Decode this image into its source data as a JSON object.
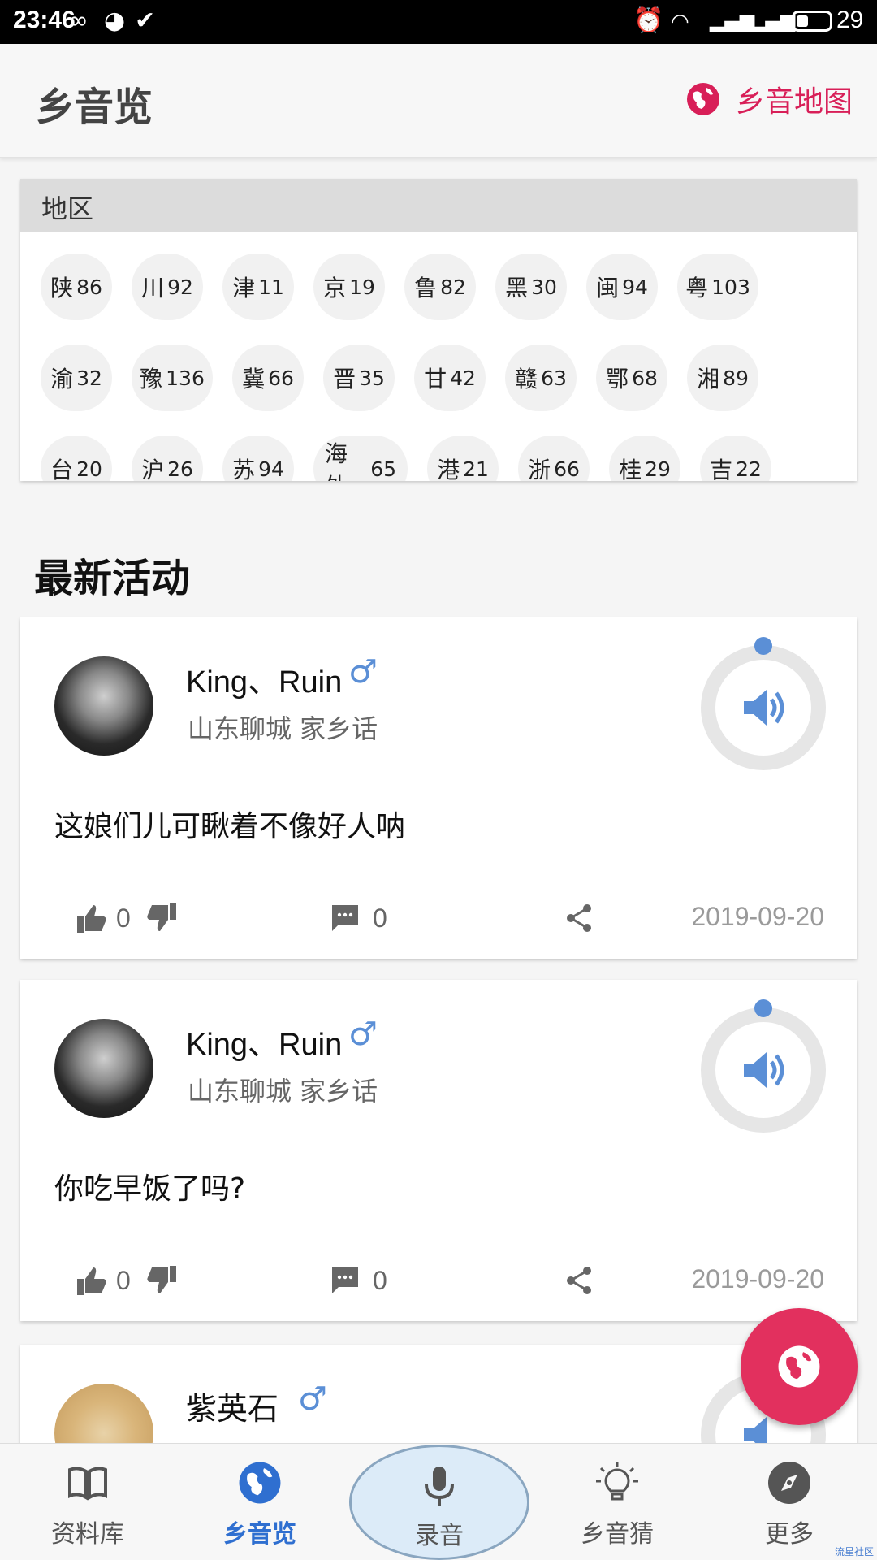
{
  "status_bar": {
    "time": "23:46",
    "battery": "29"
  },
  "app_bar": {
    "title": "乡音览",
    "map_link": "乡音地图"
  },
  "regions": {
    "header": "地区",
    "rows": [
      [
        {
          "name": "陕",
          "count": "86"
        },
        {
          "name": "川",
          "count": "92"
        },
        {
          "name": "津",
          "count": "11"
        },
        {
          "name": "京",
          "count": "19"
        },
        {
          "name": "鲁",
          "count": "82"
        },
        {
          "name": "黑",
          "count": "30"
        },
        {
          "name": "闽",
          "count": "94"
        },
        {
          "name": "粤",
          "count": "103"
        }
      ],
      [
        {
          "name": "渝",
          "count": "32"
        },
        {
          "name": "豫",
          "count": "136"
        },
        {
          "name": "冀",
          "count": "66"
        },
        {
          "name": "晋",
          "count": "35"
        },
        {
          "name": "甘",
          "count": "42"
        },
        {
          "name": "赣",
          "count": "63"
        },
        {
          "name": "鄂",
          "count": "68"
        },
        {
          "name": "湘",
          "count": "89"
        }
      ],
      [
        {
          "name": "台",
          "count": "20"
        },
        {
          "name": "沪",
          "count": "26"
        },
        {
          "name": "苏",
          "count": "94"
        },
        {
          "name": "海外",
          "count": "65"
        },
        {
          "name": "港",
          "count": "21"
        },
        {
          "name": "浙",
          "count": "66"
        },
        {
          "name": "桂",
          "count": "29"
        },
        {
          "name": "吉",
          "count": "22"
        }
      ]
    ]
  },
  "section_title": "最新活动",
  "posts": [
    {
      "user": "King、Ruin",
      "gender": "♂",
      "place": "山东聊城 家乡话",
      "content": "这娘们儿可瞅着不像好人呐",
      "likes": "0",
      "comments": "0",
      "date": "2019-09-20"
    },
    {
      "user": "King、Ruin",
      "gender": "♂",
      "place": "山东聊城 家乡话",
      "content": "你吃早饭了吗?",
      "likes": "0",
      "comments": "0",
      "date": "2019-09-20"
    },
    {
      "user": "紫英石",
      "gender": "♂"
    }
  ],
  "bottom_nav": [
    {
      "label": "资料库"
    },
    {
      "label": "乡音览"
    },
    {
      "label": "录音"
    },
    {
      "label": "乡音猜"
    },
    {
      "label": "更多"
    }
  ],
  "watermark": "流星社区",
  "colors": {
    "accent_red": "#e2305e",
    "accent_blue": "#2f6fd0",
    "player_blue": "#5b8fd6"
  }
}
